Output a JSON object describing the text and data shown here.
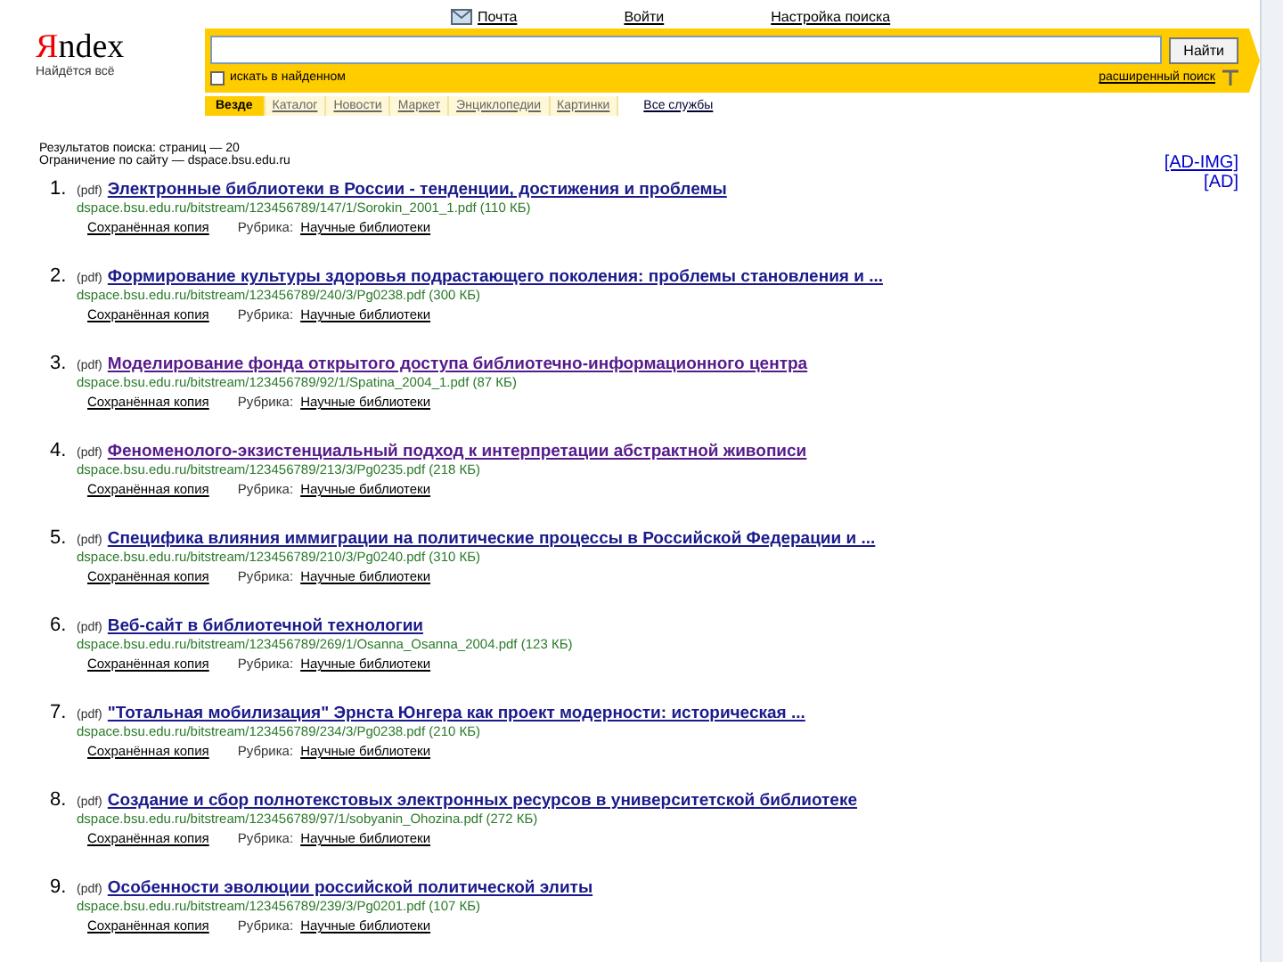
{
  "logo": {
    "text": "Яndex",
    "tagline": "Найдётся всё"
  },
  "top_links": [
    {
      "label": "Почта",
      "icon": true
    },
    {
      "label": "Войти",
      "icon": false
    },
    {
      "label": "Настройка поиска",
      "icon": false
    }
  ],
  "search": {
    "button": "Найти",
    "in_found": {
      "label": "искать в найденном",
      "checked": false
    },
    "advanced": "расширенный поиск"
  },
  "tabs": [
    {
      "label": "Везде",
      "selected": true
    },
    {
      "label": "Каталог",
      "selected": false
    },
    {
      "label": "Новости",
      "selected": false
    },
    {
      "label": "Маркет",
      "selected": false
    },
    {
      "label": "Энциклопедии",
      "selected": false
    },
    {
      "label": "Картинки",
      "selected": false
    }
  ],
  "all_services": "Все службы",
  "stats": [
    "Результатов поиска: страниц — 20",
    "Ограничение по сайту — dspace.bsu.edu.ru"
  ],
  "ads": [
    "[AD-IMG]",
    "[AD]"
  ],
  "results": [
    {
      "num": "1.",
      "type": "(pdf)",
      "title": "Электронные библиотеки в России - тенденции, достижения и проблемы",
      "visited": false,
      "url": "dspace.bsu.edu.ru/bitstream/123456789/147/1/Sorokin_2001_1.pdf (110 КБ)",
      "cache": "Сохранённая копия",
      "rubric": "Рубрика:",
      "rubric_link": "Научные библиотеки"
    },
    {
      "num": "2.",
      "type": "(pdf)",
      "title": "Формирование культуры здоровья подрастающего поколения: проблемы становления и ...",
      "visited": false,
      "url": "dspace.bsu.edu.ru/bitstream/123456789/240/3/Pg0238.pdf (300 КБ)",
      "cache": "Сохранённая копия",
      "rubric": "Рубрика:",
      "rubric_link": "Научные библиотеки"
    },
    {
      "num": "3.",
      "type": "(pdf)",
      "title": "Моделирование фонда открытого доступа библиотечно-информационного центра",
      "visited": true,
      "url": "dspace.bsu.edu.ru/bitstream/123456789/92/1/Spatina_2004_1.pdf (87 КБ)",
      "cache": "Сохранённая копия",
      "rubric": "Рубрика:",
      "rubric_link": "Научные библиотеки"
    },
    {
      "num": "4.",
      "type": "(pdf)",
      "title": "Феноменолого-экзистенциальный подход к интерпретации абстрактной живописи",
      "visited": true,
      "url": "dspace.bsu.edu.ru/bitstream/123456789/213/3/Pg0235.pdf (218 КБ)",
      "cache": "Сохранённая копия",
      "rubric": "Рубрика:",
      "rubric_link": "Научные библиотеки"
    },
    {
      "num": "5.",
      "type": "(pdf)",
      "title": "Специфика влияния иммиграции на политические процессы в Российской Федерации и ...",
      "visited": false,
      "url": "dspace.bsu.edu.ru/bitstream/123456789/210/3/Pg0240.pdf (310 КБ)",
      "cache": "Сохранённая копия",
      "rubric": "Рубрика:",
      "rubric_link": "Научные библиотеки"
    },
    {
      "num": "6.",
      "type": "(pdf)",
      "title": "Веб-сайт в библиотечной технологии",
      "visited": false,
      "url": "dspace.bsu.edu.ru/bitstream/123456789/269/1/Osanna_Osanna_2004.pdf (123 КБ)",
      "cache": "Сохранённая копия",
      "rubric": "Рубрика:",
      "rubric_link": "Научные библиотеки"
    },
    {
      "num": "7.",
      "type": "(pdf)",
      "title": "\"Тотальная мобилизация\" Эрнста Юнгера как проект модерности: историческая ...",
      "visited": false,
      "url": "dspace.bsu.edu.ru/bitstream/123456789/234/3/Pg0238.pdf (210 КБ)",
      "cache": "Сохранённая копия",
      "rubric": "Рубрика:",
      "rubric_link": "Научные библиотеки"
    },
    {
      "num": "8.",
      "type": "(pdf)",
      "title": "Создание и сбор полнотекстовых электронных ресурсов в университетской библиотеке",
      "visited": false,
      "url": "dspace.bsu.edu.ru/bitstream/123456789/97/1/sobyanin_Ohozina.pdf (272 КБ)",
      "cache": "Сохранённая копия",
      "rubric": "Рубрика:",
      "rubric_link": "Научные библиотеки"
    },
    {
      "num": "9.",
      "type": "(pdf)",
      "title": "Особенности эволюции российской политической элиты",
      "visited": false,
      "url": "dspace.bsu.edu.ru/bitstream/123456789/239/3/Pg0201.pdf (107 КБ)",
      "cache": "Сохранённая копия",
      "rubric": "Рубрика:",
      "rubric_link": "Научные библиотеки"
    }
  ]
}
